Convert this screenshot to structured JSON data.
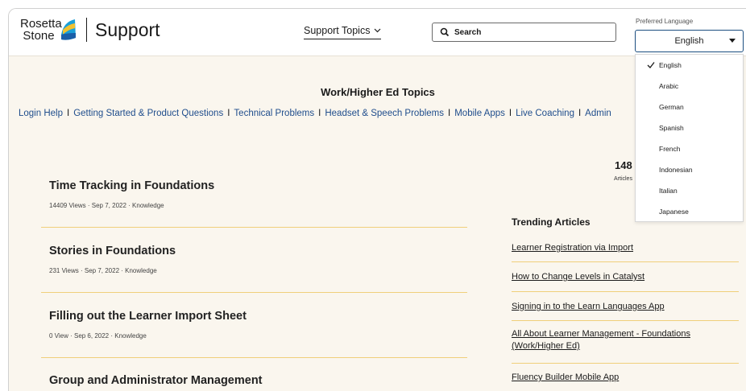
{
  "header": {
    "logo_line1": "Rosetta",
    "logo_line2": "Stone",
    "logo_support": "Support",
    "topics_label": "Support Topics",
    "search_placeholder": "Search",
    "pref_lang_label": "Preferred Language",
    "selected_language": "English"
  },
  "language_options": [
    "English",
    "Arabic",
    "German",
    "Spanish",
    "French",
    "Indonesian",
    "Italian",
    "Japanese"
  ],
  "main": {
    "section_title": "Work/Higher Ed Topics",
    "topic_links": [
      "Login Help",
      "Getting Started & Product Questions",
      "Technical Problems",
      "Headset & Speech Problems",
      "Mobile Apps",
      "Live Coaching",
      "Admin"
    ],
    "separator": "I"
  },
  "articles": [
    {
      "title": "Time Tracking in Foundations",
      "meta": "14409 Views · Sep 7, 2022 · Knowledge"
    },
    {
      "title": "Stories in Foundations",
      "meta": "231 Views · Sep 7, 2022 · Knowledge"
    },
    {
      "title": "Filling out the Learner Import Sheet",
      "meta": "0 View · Sep 6, 2022 · Knowledge"
    },
    {
      "title": "Group and Administrator Management",
      "meta": ""
    }
  ],
  "stats": {
    "count_partial": "148",
    "label_partial": "Articles"
  },
  "trending": {
    "title": "Trending Articles",
    "items": [
      "Learner Registration via Import",
      "How to Change Levels in Catalyst",
      "Signing in to the Learn Languages App",
      "All About Learner Management - Foundations (Work/Higher Ed)",
      "Fluency Builder Mobile App"
    ]
  },
  "colors": {
    "link": "#1f4d8c",
    "accent_rule": "#f0cf7a",
    "select_border": "#1c4e80",
    "background": "#faf6ee"
  }
}
